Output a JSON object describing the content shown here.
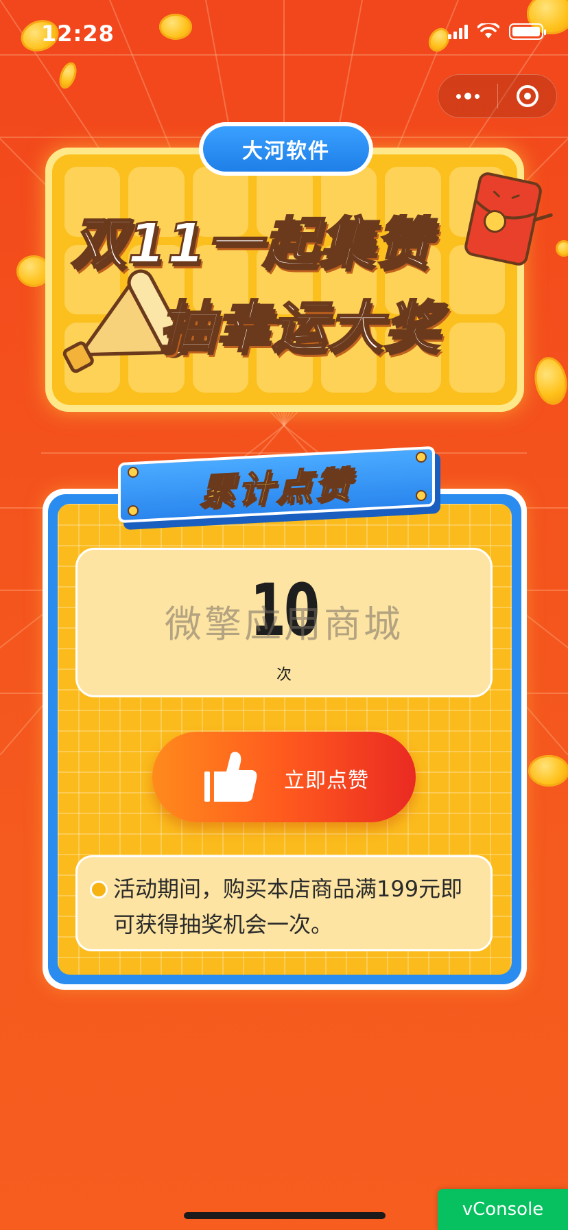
{
  "status_bar": {
    "time": "12:28"
  },
  "banner": {
    "brand": "大河软件",
    "title_line1": "双11一起集赞",
    "title_line2": "抽幸运大奖"
  },
  "card": {
    "label": "累计点赞",
    "count": "10",
    "count_unit": "次",
    "watermark": "微擎应用商城",
    "like_button_label": "立即点赞",
    "notice": "活动期间，购买本店商品满199元即可获得抽奖机会一次。"
  },
  "debug": {
    "vconsole_label": "vConsole"
  },
  "icons": {
    "capsule_more": "more-dots-icon",
    "capsule_close": "circle-close-icon",
    "like": "thumbs-up-icon"
  },
  "colors": {
    "background": "#f2461c",
    "card_blue": "#2b8cf0",
    "card_yellow": "#fbbb1c",
    "button_orange": "#ff5a1e",
    "vconsole_green": "#07c160"
  }
}
